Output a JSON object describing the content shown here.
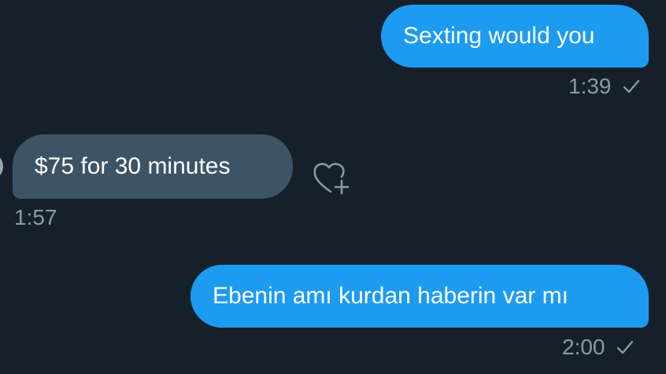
{
  "messages": [
    {
      "direction": "sent",
      "text": "Sexting would you",
      "time": "1:39",
      "status_icon": "check-icon"
    },
    {
      "direction": "received",
      "text": "$75 for 30 minutes",
      "time": "1:57",
      "reaction_icon": "heart-plus-icon"
    },
    {
      "direction": "sent",
      "text": "Ebenin amı kurdan haberin var mı",
      "time": "2:00",
      "status_icon": "check-icon"
    }
  ],
  "colors": {
    "background": "#15202b",
    "sent_bubble": "#1d9bf0",
    "received_bubble": "#3d5466",
    "meta_text": "#8b98a5"
  }
}
